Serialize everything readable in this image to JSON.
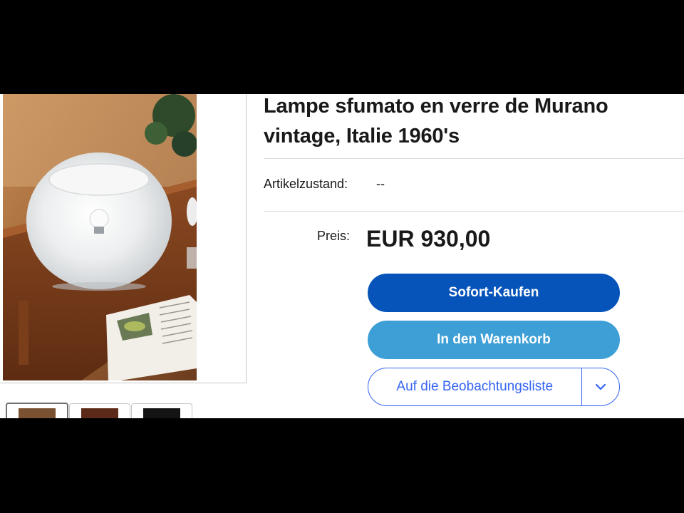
{
  "listing": {
    "title": "Lampe sfumato en verre de Murano vintage, Italie 1960's",
    "condition_label": "Artikelzustand:",
    "condition_value": "--",
    "price_label": "Preis:",
    "price_value": "EUR 930,00"
  },
  "actions": {
    "buy_now": "Sofort-Kaufen",
    "add_to_cart": "In den Warenkorb",
    "watchlist": "Auf die Beobachtungsliste"
  },
  "icons": {
    "watchlist_dropdown": "chevron-down-icon"
  },
  "colors": {
    "buy_now": "#0654ba",
    "add_to_cart": "#3d9fd6",
    "watchlist_accent": "#3665f3"
  }
}
